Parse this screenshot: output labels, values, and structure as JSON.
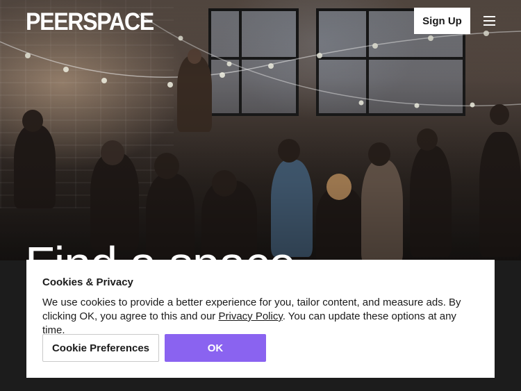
{
  "header": {
    "logo_text": "PEERSPACE",
    "signup_label": "Sign Up",
    "menu_icon": "hamburger-menu-icon"
  },
  "hero": {
    "title": "Find a space"
  },
  "cookie_banner": {
    "title": "Cookies & Privacy",
    "text_before_link": "We use cookies to provide a better experience for you, tailor content, and measure ads. By clicking OK, you agree to this and our ",
    "link_text": "Privacy Policy",
    "text_after_link": ". You can update these options at any time.",
    "preferences_label": "Cookie Preferences",
    "ok_label": "OK"
  },
  "colors": {
    "accent": "#8a63f0",
    "background": "#1c1c1c",
    "banner": "#ffffff"
  }
}
